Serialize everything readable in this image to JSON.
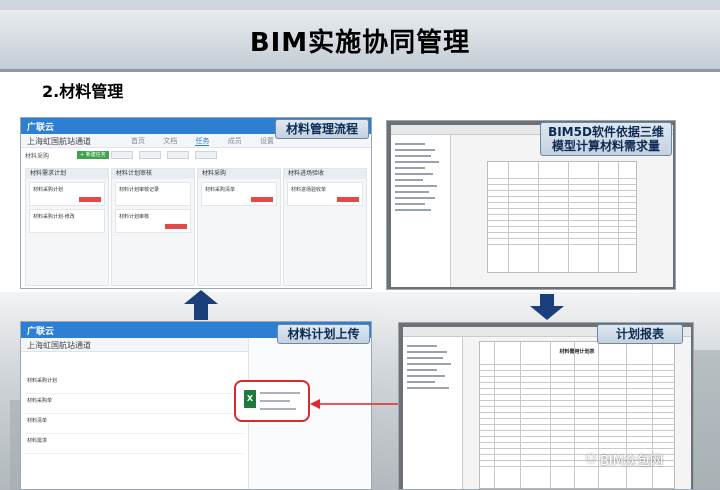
{
  "title": "BIM实施协同管理",
  "subtitle": "2.材料管理",
  "callouts": {
    "workflow": "材料管理流程",
    "bim5d": "BIM5D软件依据三维模型计算材料需求量",
    "upload": "材料计划上传",
    "report": "计划报表"
  },
  "app": {
    "logo": "广联云",
    "project": "上海虹国航站通道",
    "tabs": [
      "首页",
      "文档",
      "任务",
      "成员",
      "设置"
    ],
    "toolbar_title": "材料采购",
    "new_task": "+ 新建任务",
    "columns": [
      "材料需求计划",
      "材料计划审核",
      "材料采购",
      "材料进场验收"
    ],
    "cards": [
      [
        "材料采购计划",
        "材料采购计划-修改"
      ],
      [
        "材料计划审核记录",
        "材料计划审核"
      ],
      [
        "材料采购清单"
      ],
      [
        "材料进场验收单"
      ]
    ]
  },
  "upload_view": {
    "items": [
      "材料采购计划",
      "材料采购单",
      "材料清单",
      "材料需求"
    ],
    "file_name": "材料采购计划.xlsx"
  },
  "report": {
    "sheet_title": "材料需用计划表"
  },
  "watermark": "BIM众包网",
  "colors": {
    "app_blue": "#2d7fd3",
    "highlight_red": "#e0262f",
    "arrow_navy": "#1b3f7a",
    "excel_green": "#1f7a3b"
  }
}
